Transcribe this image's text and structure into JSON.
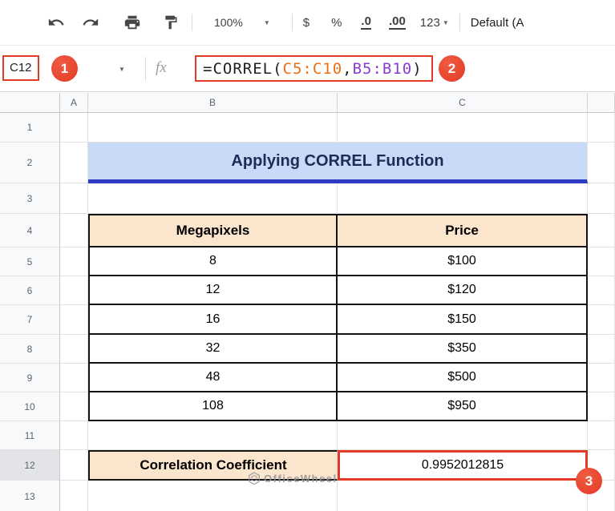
{
  "toolbar": {
    "zoom": "100%",
    "currency": "$",
    "percent": "%",
    "dec_decrease": ".0",
    "dec_increase": ".00",
    "more_formats": "123",
    "font": "Default (A"
  },
  "formula_bar": {
    "name_box": "C12",
    "fx": "fx",
    "formula": {
      "f1": "=CORREL(",
      "range1": "C5:C10",
      "comma": ",",
      "range2": "B5:B10",
      "close": ")"
    }
  },
  "annotations": {
    "step1": "1",
    "step2": "2",
    "step3": "3"
  },
  "icons": {
    "caret": "▼"
  },
  "grid": {
    "columns": [
      "A",
      "B",
      "C"
    ],
    "rows": [
      "1",
      "2",
      "3",
      "4",
      "5",
      "6",
      "7",
      "8",
      "9",
      "10",
      "11",
      "12",
      "13"
    ]
  },
  "sheet": {
    "title": "Applying CORREL Function",
    "table": {
      "headers": {
        "b": "Megapixels",
        "c": "Price"
      },
      "rows": [
        {
          "b": "8",
          "c": "$100"
        },
        {
          "b": "12",
          "c": "$120"
        },
        {
          "b": "16",
          "c": "$150"
        },
        {
          "b": "32",
          "c": "$350"
        },
        {
          "b": "48",
          "c": "$500"
        },
        {
          "b": "108",
          "c": "$950"
        }
      ]
    },
    "result": {
      "label": "Correlation Coefficient",
      "value": "0.9952012815"
    }
  },
  "watermark": "OfficeWheel",
  "colors": {
    "annotation_red": "#e23a24",
    "title_bg": "#c9daf8",
    "title_underline": "#2d3bc4",
    "title_color": "#1f2a56",
    "header_bg": "#fce5cd",
    "range1_color": "#ea7014",
    "range2_color": "#8a3ccf"
  }
}
